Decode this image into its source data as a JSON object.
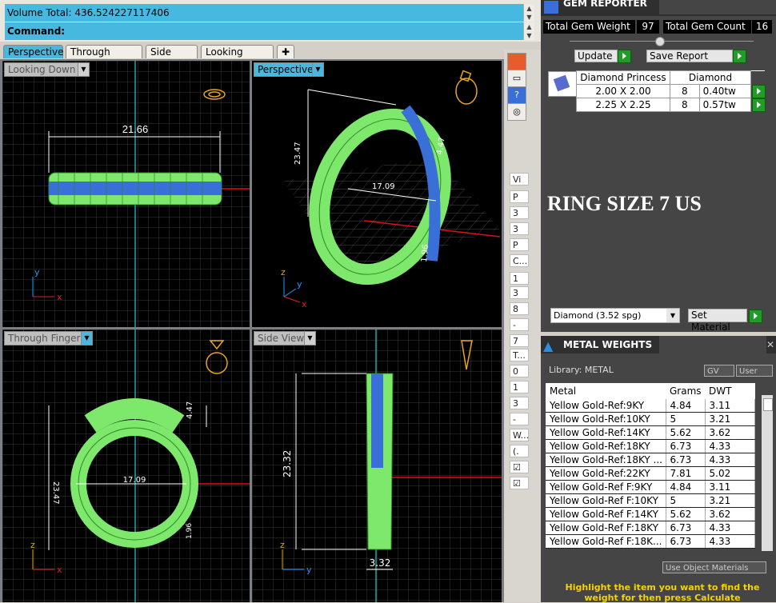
{
  "command_bar": {
    "volume_line": "Volume Total: 436.524227117406",
    "command_label": "Command:"
  },
  "view_tabs": [
    "Perspective",
    "Through Finger",
    "Side View",
    "Looking Down",
    "✚"
  ],
  "viewports": {
    "top_left": {
      "label": "Looking Down",
      "dimension": "21.66"
    },
    "top_right": {
      "label": "Perspective",
      "dims": [
        "23.47",
        "4.47",
        "17.09",
        "1.96"
      ]
    },
    "bottom_left": {
      "label": "Through Finger",
      "dims": [
        "23.47",
        "4.47",
        "17.09",
        "1.96"
      ]
    },
    "bottom_right": {
      "label": "Side View",
      "dims": [
        "23.32",
        "3.32"
      ]
    },
    "axis_labels": {
      "x": "x",
      "y": "y",
      "z": "z"
    },
    "overlay_text": "RING SIZE 7 US"
  },
  "side_strip": {
    "rows": [
      "Vi",
      "P",
      "3",
      "3",
      "P",
      "C...",
      "1",
      "3",
      "8",
      "-",
      "7",
      "T...",
      "0",
      "1",
      "3",
      "-",
      "W...",
      "(.",
      "☑",
      "☑"
    ]
  },
  "gem_reporter": {
    "title": "GEM REPORTER",
    "total_gem_weight_label": "Total Gem Weight",
    "total_gem_weight_value": "97",
    "total_gem_count_label": "Total Gem Count",
    "total_gem_count_value": "16",
    "update_label": "Update",
    "save_report_label": "Save Report",
    "table_headers": [
      "Diamond Princess",
      "Diamond"
    ],
    "rows": [
      {
        "size": "2.00 X 2.00",
        "count": "8",
        "weight": "0.40tw"
      },
      {
        "size": "2.25 X 2.25",
        "count": "8",
        "weight": "0.57tw"
      }
    ],
    "material_select": "Diamond     (3.52 spg)",
    "set_material_label": "Set Material"
  },
  "metal_weights": {
    "title": "METAL WEIGHTS",
    "library_label": "Library: METAL",
    "gv_label": "GV",
    "user_label": "User",
    "columns": [
      "Metal",
      "Grams",
      "DWT"
    ],
    "rows": [
      {
        "metal": "Yellow Gold-Ref:9KY",
        "grams": "4.84",
        "dwt": "3.11"
      },
      {
        "metal": "Yellow Gold-Ref:10KY",
        "grams": "5",
        "dwt": "3.21"
      },
      {
        "metal": "Yellow Gold-Ref:14KY",
        "grams": "5.62",
        "dwt": "3.62"
      },
      {
        "metal": "Yellow Gold-Ref:18KY",
        "grams": "6.73",
        "dwt": "4.33"
      },
      {
        "metal": "Yellow Gold-Ref:18KY ...",
        "grams": "6.73",
        "dwt": "4.33"
      },
      {
        "metal": "Yellow Gold-Ref:22KY",
        "grams": "7.81",
        "dwt": "5.02"
      },
      {
        "metal": "Yellow Gold-Ref F:9KY",
        "grams": "4.84",
        "dwt": "3.11"
      },
      {
        "metal": "Yellow Gold-Ref F:10KY",
        "grams": "5",
        "dwt": "3.21"
      },
      {
        "metal": "Yellow Gold-Ref F:14KY",
        "grams": "5.62",
        "dwt": "3.62"
      },
      {
        "metal": "Yellow Gold-Ref F:18KY",
        "grams": "6.73",
        "dwt": "4.33"
      },
      {
        "metal": "Yellow Gold-Ref F:18K...",
        "grams": "6.73",
        "dwt": "4.33"
      }
    ],
    "use_object_materials_label": "Use Object Materials",
    "hint_text": "Highlight the item you want to find the weight for then press Calculate"
  },
  "colors": {
    "accent": "#47b8df",
    "ring_green": "#7ee86c",
    "stone_blue": "#3a6fd8",
    "panel_dark": "#454545",
    "hint_yellow": "#f5d400"
  }
}
